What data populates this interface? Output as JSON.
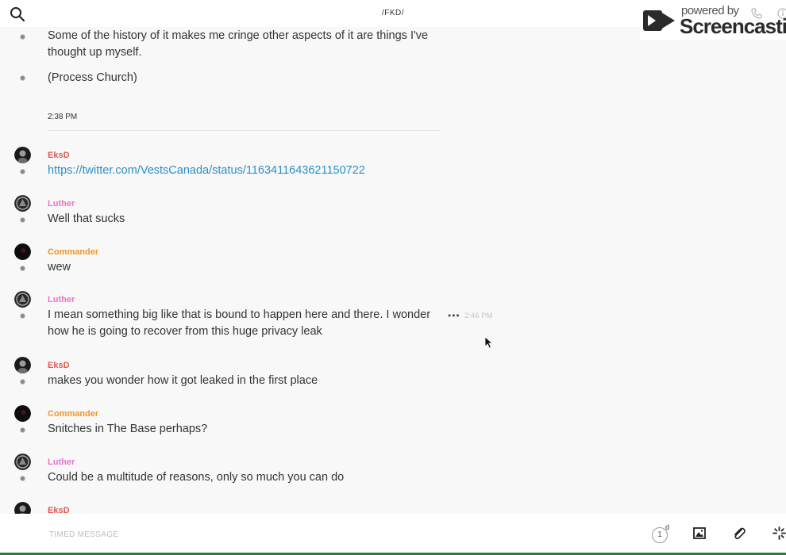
{
  "app": {
    "room_title": "/FKD/"
  },
  "watermark": {
    "top_text": "powered by",
    "brand": "Screencastify"
  },
  "colors": {
    "eksd": "#e05a52",
    "luther": "#e673c9",
    "commander": "#f0962d",
    "link": "#2b8fc7"
  },
  "messages": {
    "m0_line1": "Some of the history of it makes me cringe other aspects of it are things I've",
    "m0_line2": "thought up myself.",
    "m1": "(Process Church)",
    "time_divider": "2:38 PM",
    "m2_author": "EksD",
    "m2_link": "https://twitter.com/VestsCanada/status/1163411643621150722",
    "m3_author": "Luther",
    "m3_text": "Well that sucks",
    "m4_author": "Commander",
    "m4_text": "wew",
    "m5_author": "Luther",
    "m5_line1": "I mean something big like that is bound to happen here and there. I wonder",
    "m5_line2": "how he is going to recover from this huge privacy leak",
    "m5_more": "•••",
    "m5_time": "2:46 PM",
    "m6_author": "EksD",
    "m6_text": "makes you wonder how it got leaked in the first place",
    "m7_author": "Commander",
    "m7_text": "Snitches in The Base perhaps?",
    "m8_author": "Luther",
    "m8_text": "Could be a multitude of reasons, only so much you can do",
    "m9_author": "EksD"
  },
  "composer": {
    "placeholder": "TIMED MESSAGE",
    "timer_value": "1",
    "timer_unit": "d"
  },
  "icons": {
    "search": "search-icon",
    "image": "image-icon",
    "attach": "paperclip-icon",
    "sparkle": "sparkle-icon"
  }
}
